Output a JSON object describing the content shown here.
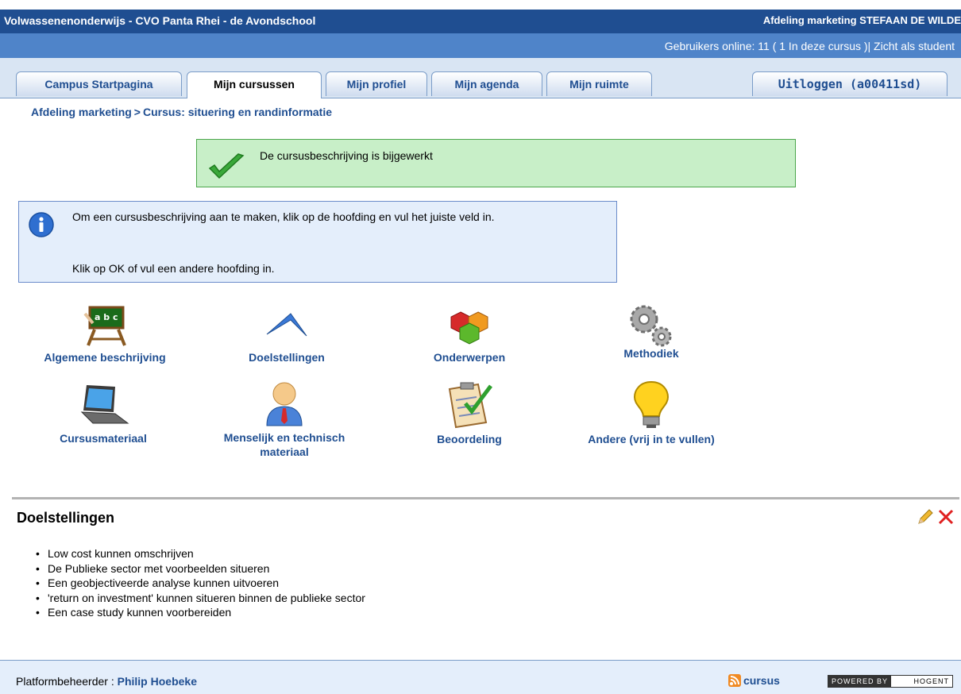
{
  "header": {
    "site_title": "Volwassenenonderwijs - CVO Panta Rhei - de Avondschool",
    "department_user": "Afdeling marketing STEFAAN DE WILDE"
  },
  "subbar": {
    "status": "Gebruikers online:  11  ( 1 In deze cursus  )|  Zicht als student"
  },
  "tabs": {
    "campus": "Campus Startpagina",
    "courses": "Mijn cursussen",
    "profile": "Mijn profiel",
    "agenda": "Mijn agenda",
    "space": "Mijn ruimte",
    "logout": "Uitloggen (a00411sd)"
  },
  "breadcrumb": {
    "dept": "Afdeling marketing",
    "sep": ">",
    "course": "Cursus: situering en randinformatie"
  },
  "success": {
    "message": "De cursusbeschrijving is bijgewerkt"
  },
  "info": {
    "line1": "Om een cursusbeschrijving aan te maken, klik op de hoofding en vul het juiste veld in.",
    "line2": "Klik op OK of vul een andere hoofding in."
  },
  "sections": {
    "algemeen": "Algemene beschrijving",
    "doelstellingen": "Doelstellingen",
    "onderwerpen": "Onderwerpen",
    "methodiek": "Methodiek",
    "cursusmateriaal": "Cursusmateriaal",
    "menselijk_1": "Menselijk en technisch",
    "menselijk_2": "materiaal",
    "beoordeling": "Beoordeling",
    "andere": "Andere (vrij in te vullen)"
  },
  "content": {
    "title": "Doelstellingen",
    "items": [
      "Low cost kunnen omschrijven",
      "De Publieke sector met voorbeelden situeren",
      "Een geobjectiveerde analyse kunnen uitvoeren",
      "'return on investment' kunnen situeren binnen de publieke sector",
      "Een case study kunnen voorbereiden"
    ]
  },
  "footer": {
    "admin_label": "Platformbeheerder : ",
    "admin_name": "Philip Hoebeke",
    "rss": "cursus",
    "powered_by": "POWERED BY",
    "hogent": "HOGENT"
  },
  "colors": {
    "header_bg": "#1f4e91",
    "subbar_bg": "#4f84c9",
    "link": "#1f4e91",
    "success_bg": "#c8efc8",
    "info_bg": "#e4eefb"
  }
}
